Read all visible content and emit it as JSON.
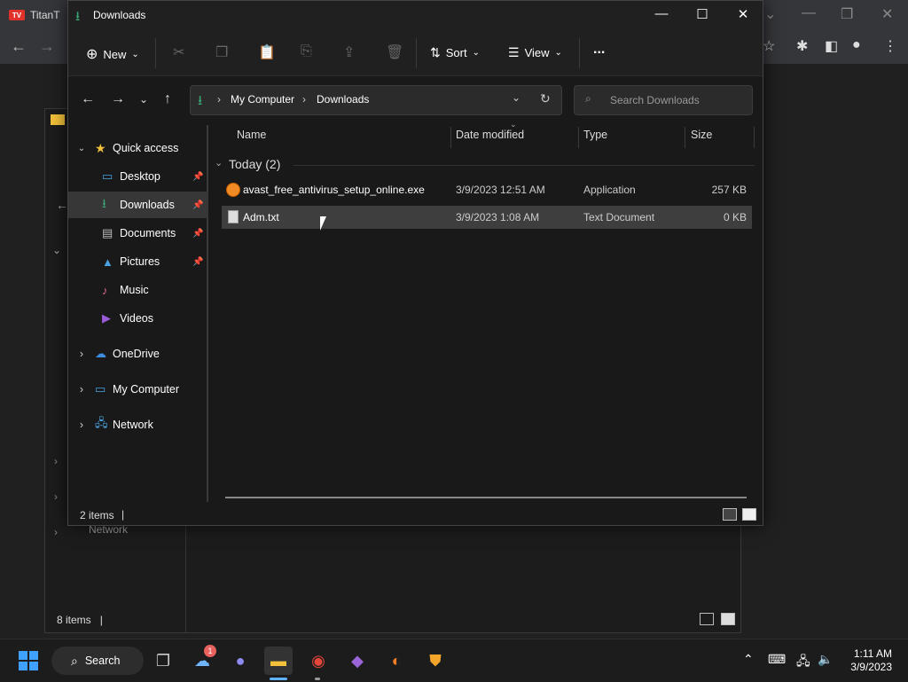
{
  "chrome": {
    "tab_title": "TitanT",
    "tab_icon_text": "TV"
  },
  "bg_window": {
    "status": "8 items",
    "network_label": "Network"
  },
  "window": {
    "title": "Downloads",
    "commands": {
      "new_label": "New",
      "sort_label": "Sort",
      "view_label": "View",
      "more_label": "..."
    },
    "address": {
      "parts": [
        "My Computer",
        "Downloads"
      ]
    },
    "search_placeholder": "Search Downloads",
    "sidebar": {
      "quick_access": "Quick access",
      "items": [
        {
          "label": "Desktop",
          "pinned": true
        },
        {
          "label": "Downloads",
          "pinned": true,
          "selected": true
        },
        {
          "label": "Documents",
          "pinned": true
        },
        {
          "label": "Pictures",
          "pinned": true
        },
        {
          "label": "Music",
          "pinned": false
        },
        {
          "label": "Videos",
          "pinned": false
        }
      ],
      "roots": [
        "OneDrive",
        "My Computer",
        "Network"
      ]
    },
    "columns": {
      "name": "Name",
      "date": "Date modified",
      "type": "Type",
      "size": "Size"
    },
    "group_label": "Today (2)",
    "files": [
      {
        "name": "avast_free_antivirus_setup_online.exe",
        "date": "3/9/2023 12:51 AM",
        "type": "Application",
        "size": "257 KB",
        "icon": "avast-icon"
      },
      {
        "name": "Adm.txt",
        "date": "3/9/2023 1:08 AM",
        "type": "Text Document",
        "size": "0 KB",
        "icon": "text-file-icon",
        "selected": true
      }
    ],
    "status": "2 items"
  },
  "taskbar": {
    "search_label": "Search",
    "notification_badge": "1",
    "time": "1:11 AM",
    "date": "3/9/2023"
  },
  "colors": {
    "accent_green": "#3aa675",
    "folder_yellow": "#f3c13a"
  }
}
